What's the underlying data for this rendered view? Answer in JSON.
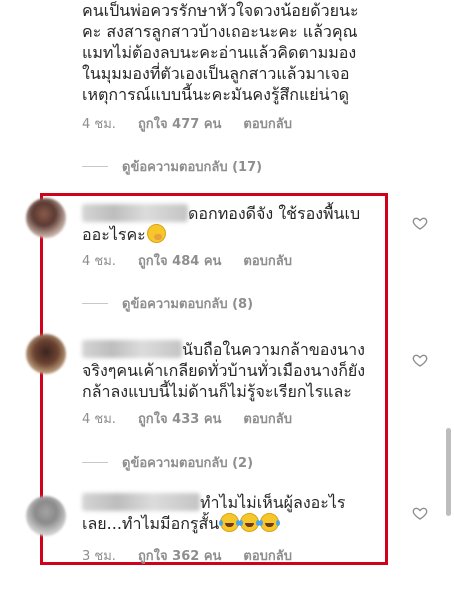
{
  "top_comment": {
    "text_lines": [
      "คนเป็นพ่อควรรักษาหัวใจดวงน้อยด้วยนะ",
      "คะ สงสารลูกสาวบ้างเถอะนะคะ แล้วคุณ",
      "แมทไม่ต้องลบนะคะอ่านแล้วคิดตามมอง",
      "ในมุมมองที่ตัวเองเป็นลูกสาวแล้วมาเจอ",
      "เหตุการณ์แบบนี้นะคะมันคงรู้สึกแย่น่าดู"
    ],
    "time": "4 ชม.",
    "likes": "ถูกใจ 477 คน",
    "reply": "ตอบกลับ",
    "view_replies": "ดูข้อความตอบกลับ (17)"
  },
  "comment_1": {
    "line1": "ดอกทองดีจัง ใช้รองพื้นเบ",
    "line2": "ออะไรคะ",
    "time": "4 ชม.",
    "likes": "ถูกใจ 484 คน",
    "reply": "ตอบกลับ",
    "view_replies": "ดูข้อความตอบกลับ (8)"
  },
  "comment_2": {
    "line1": "นับถือในความกล้าของนาง",
    "line2": "จริงๆคนเค้าเกลียดทั่วบ้านทั่วเมืองนางก็ยัง",
    "line3": "กล้าลงแบบนี้ไม่ด้านก็ไม่รู้จะเรียกไรและ",
    "time": "4 ชม.",
    "likes": "ถูกใจ 433 คน",
    "reply": "ตอบกลับ",
    "view_replies": "ดูข้อความตอบกลับ (2)"
  },
  "comment_3": {
    "line1": "ทำไมไม่เห็นผู้ลงอะไร",
    "line2": "เลย...ทำไมมีอกรูสั้น",
    "time": "3 ชม.",
    "likes": "ถูกใจ 362 คน",
    "reply": "ตอบกลับ"
  },
  "icons": {
    "like": "heart-icon",
    "emoji_hand": "face-with-hand-over-mouth-emoji",
    "emoji_joy": "face-with-tears-of-joy-emoji"
  },
  "colors": {
    "highlight": "#d0021b",
    "meta": "#8e8e8e",
    "text": "#262626"
  }
}
